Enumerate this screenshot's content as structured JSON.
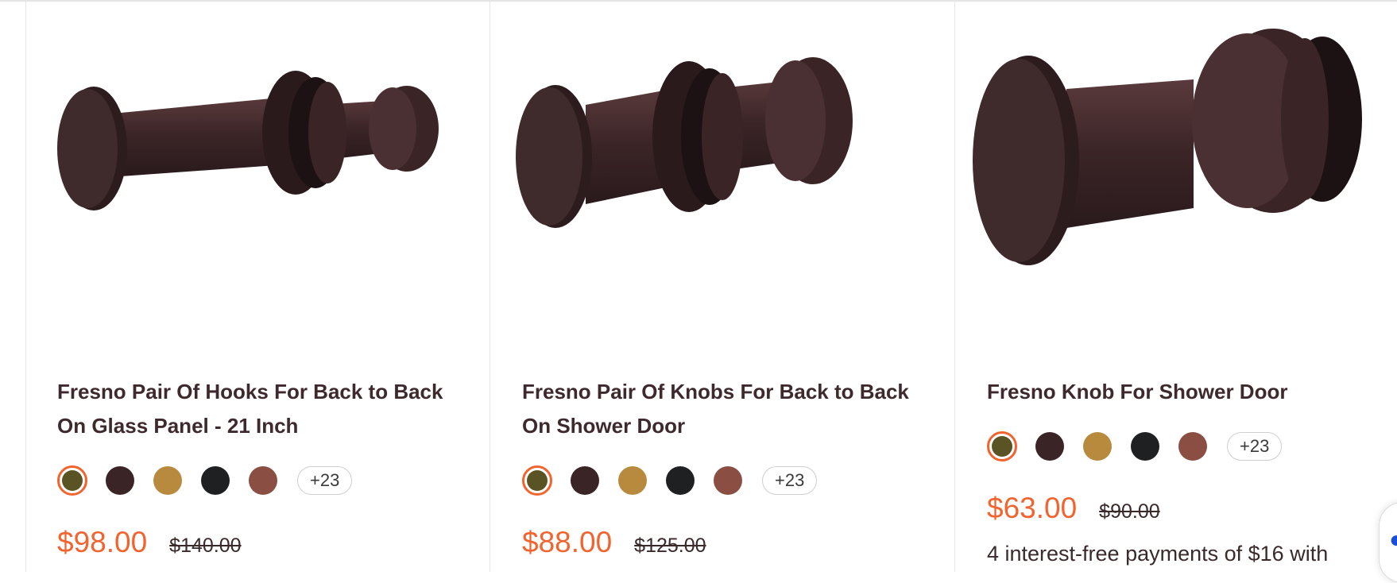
{
  "products": [
    {
      "title_line1": "Fresno Pair Of Hooks For Back to Back",
      "title_line2": "On Glass Panel - 21 Inch",
      "swatches": [
        "#5a5424",
        "#3a2426",
        "#b88a3e",
        "#1f2022",
        "#8a4e42"
      ],
      "more_label": "+23",
      "price": "$98.00",
      "old_price": "$140.00"
    },
    {
      "title_line1": "Fresno Pair Of Knobs For Back to Back",
      "title_line2": "On Shower Door",
      "swatches": [
        "#5a5424",
        "#3a2426",
        "#b88a3e",
        "#1f2022",
        "#8a4e42"
      ],
      "more_label": "+23",
      "price": "$88.00",
      "old_price": "$125.00"
    },
    {
      "title_line1": "Fresno Knob For Shower Door",
      "title_line2": "",
      "swatches": [
        "#5a5424",
        "#3a2426",
        "#b88a3e",
        "#1f2022",
        "#8a4e42"
      ],
      "more_label": "+23",
      "price": "$63.00",
      "old_price": "$90.00",
      "payment_note": "4 interest-free payments of $16 with"
    }
  ],
  "colors": {
    "accent": "#f2642f",
    "product_finish": "#3d2628"
  }
}
